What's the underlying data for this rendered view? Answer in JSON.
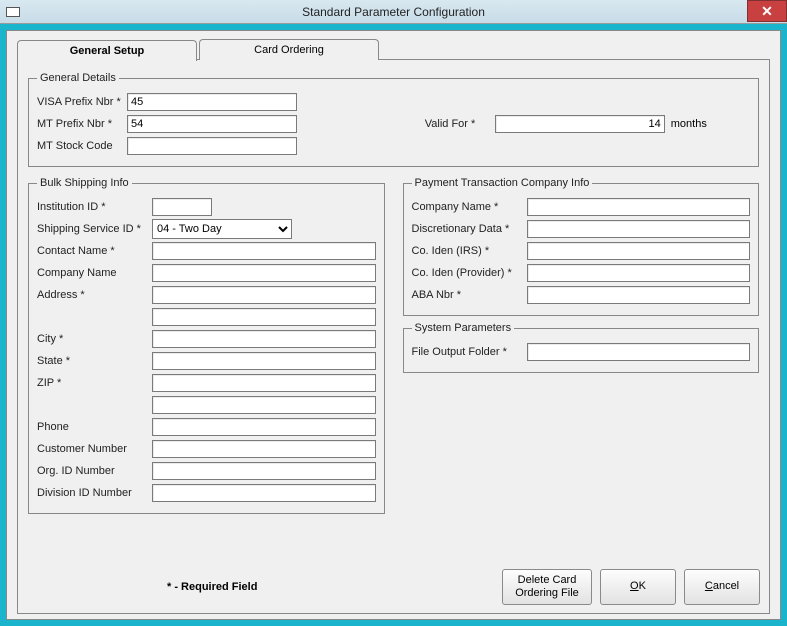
{
  "window": {
    "title": "Standard Parameter Configuration",
    "close_glyph": "✕"
  },
  "tabs": {
    "general": "General Setup",
    "card_ordering": "Card Ordering"
  },
  "general_details": {
    "legend": "General Details",
    "visa_prefix_label": "VISA Prefix Nbr *",
    "visa_prefix_value": "45",
    "mt_prefix_label": "MT Prefix Nbr *",
    "mt_prefix_value": "54",
    "mt_stock_label": "MT Stock Code",
    "mt_stock_value": "",
    "valid_for_label": "Valid For *",
    "valid_for_value": "14",
    "valid_for_suffix": "months"
  },
  "bulk": {
    "legend": "Bulk Shipping Info",
    "institution_label": "Institution ID *",
    "institution_value": "",
    "shipping_svc_label": "Shipping Service ID *",
    "shipping_svc_value": "04 - Two Day",
    "contact_label": "Contact Name *",
    "contact_value": "",
    "company_label": "Company Name",
    "company_value": "",
    "address_label": "Address *",
    "address_value": "",
    "address2_value": "",
    "city_label": "City *",
    "city_value": "",
    "state_label": "State *",
    "state_value": "",
    "zip_label": "ZIP *",
    "zip_value": "",
    "zip2_value": "",
    "phone_label": "Phone",
    "phone_value": "",
    "custnum_label": "Customer Number",
    "custnum_value": "",
    "orgid_label": "Org. ID Number",
    "orgid_value": "",
    "divid_label": "Division ID Number",
    "divid_value": ""
  },
  "payco": {
    "legend": "Payment Transaction Company Info",
    "company_label": "Company Name *",
    "company_value": "",
    "disc_label": "Discretionary Data *",
    "disc_value": "",
    "irs_label": "Co. Iden (IRS) *",
    "irs_value": "",
    "prov_label": "Co. Iden (Provider) *",
    "prov_value": "",
    "aba_label": "ABA Nbr *",
    "aba_value": ""
  },
  "sys": {
    "legend": "System Parameters",
    "folder_label": "File Output Folder *",
    "folder_value": ""
  },
  "footer": {
    "required_note": "* - Required Field",
    "delete_btn": "Delete Card\nOrdering File",
    "ok_btn": "OK",
    "cancel_btn": "Cancel"
  }
}
